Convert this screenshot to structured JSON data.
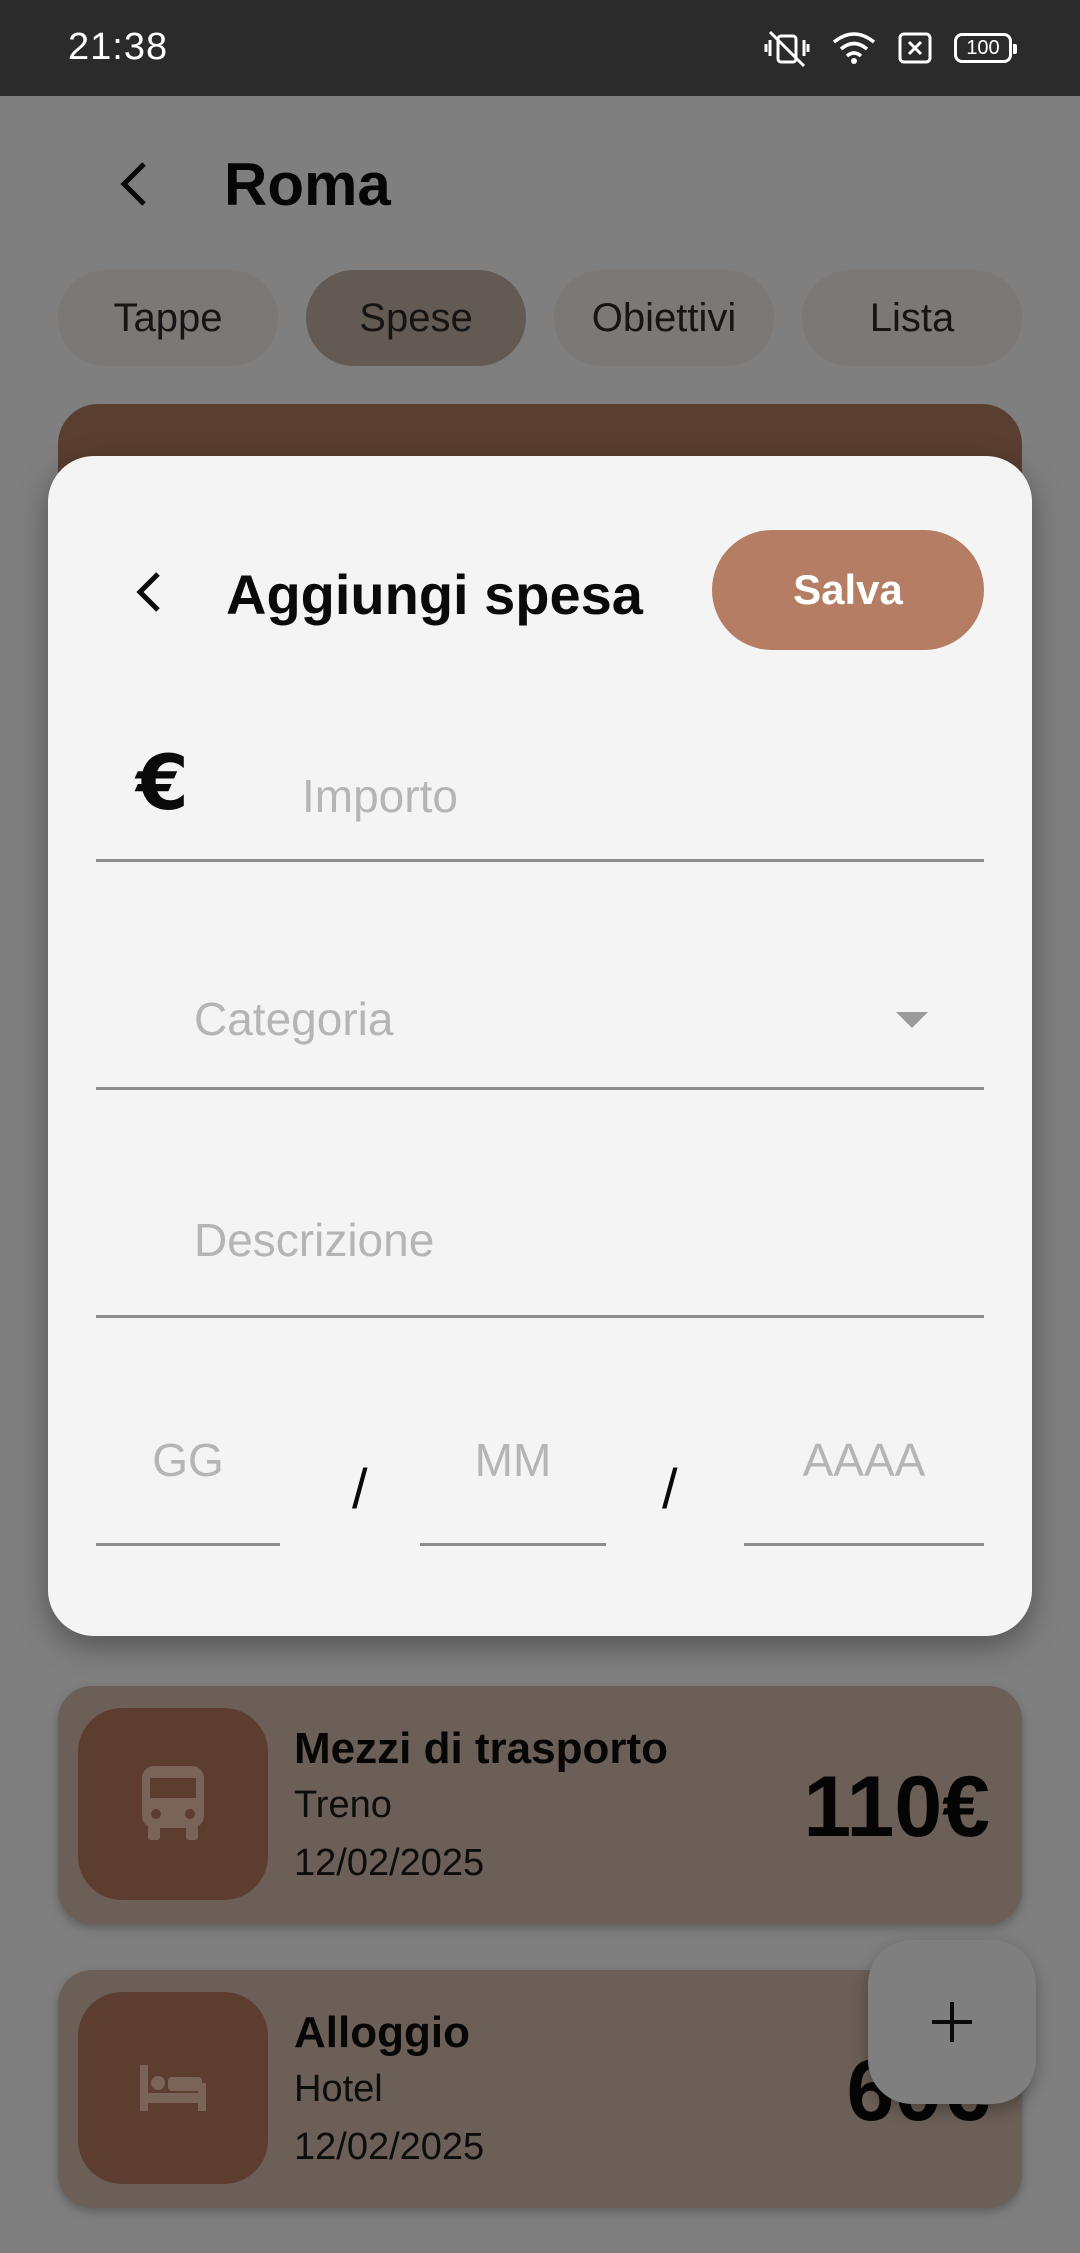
{
  "status_bar": {
    "time": "21:38",
    "battery": "100",
    "icons": [
      "vibrate-off-icon",
      "wifi-icon",
      "sim-x-icon",
      "battery-icon"
    ]
  },
  "header": {
    "title": "Roma",
    "back_icon": "chevron-left-icon"
  },
  "tabs": [
    {
      "label": "Tappe",
      "active": false
    },
    {
      "label": "Spese",
      "active": true
    },
    {
      "label": "Obiettivi",
      "active": false
    },
    {
      "label": "Lista",
      "active": false
    }
  ],
  "expenses": [
    {
      "category": "Mezzi di trasporto",
      "description": "Treno",
      "date": "12/02/2025",
      "amount": "110€",
      "icon": "bus-icon"
    },
    {
      "category": "Alloggio",
      "description": "Hotel",
      "date": "12/02/2025",
      "amount": "60€",
      "icon": "bed-icon"
    }
  ],
  "fab": {
    "icon": "plus-icon"
  },
  "dialog": {
    "title": "Aggiungi spesa",
    "save_label": "Salva",
    "currency_symbol": "€",
    "amount_placeholder": "Importo",
    "category_placeholder": "Categoria",
    "description_placeholder": "Descrizione",
    "day_placeholder": "GG",
    "month_placeholder": "MM",
    "year_placeholder": "AAAA",
    "date_separator": "/"
  },
  "colors": {
    "accent": "#b57d64",
    "card_bg": "#6b5f57",
    "icon_box": "#5c3d30",
    "dialog_bg": "#f4f4f4"
  }
}
